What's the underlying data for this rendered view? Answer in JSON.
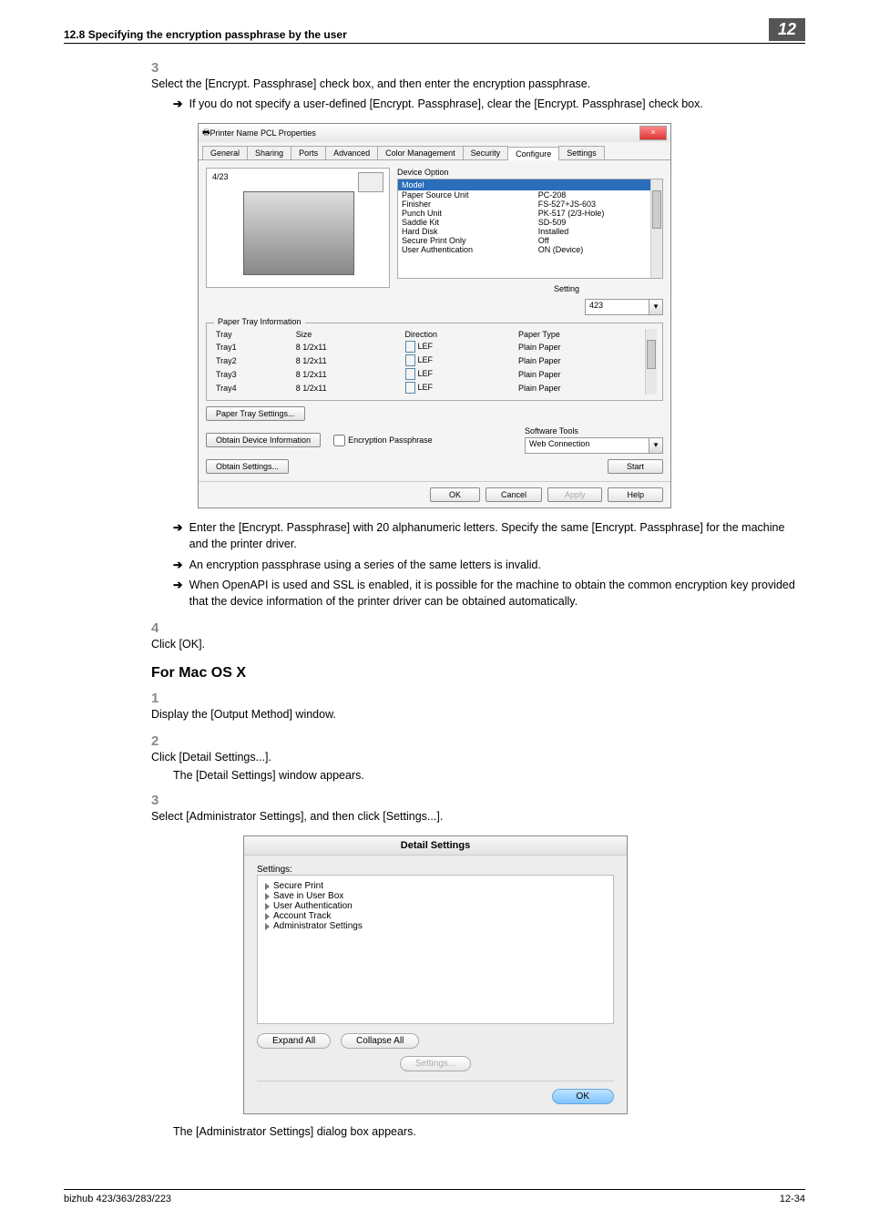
{
  "header": {
    "left": "12.8   Specifying the encryption passphrase by the user",
    "right": "12"
  },
  "step3": {
    "num": "3",
    "text": "Select the [Encrypt. Passphrase] check box, and then enter the encryption passphrase.",
    "sub1": "If you do not specify a user-defined [Encrypt. Passphrase], clear the [Encrypt. Passphrase] check box."
  },
  "dialog1": {
    "title": "Printer Name PCL Properties",
    "tabs": [
      "General",
      "Sharing",
      "Ports",
      "Advanced",
      "Color Management",
      "Security",
      "Configure",
      "Settings"
    ],
    "activeTab": "Configure",
    "previewNum": "4/23",
    "devopt_label": "Device Option",
    "model_label": "Model",
    "rows": [
      {
        "k": "Paper Source Unit",
        "v": "PC-208"
      },
      {
        "k": "Finisher",
        "v": "FS-527+JS-603"
      },
      {
        "k": "Punch Unit",
        "v": "PK-517 (2/3-Hole)"
      },
      {
        "k": "Saddle Kit",
        "v": "SD-509"
      },
      {
        "k": "Hard Disk",
        "v": "Installed"
      },
      {
        "k": "Secure Print Only",
        "v": "Off"
      },
      {
        "k": "User Authentication",
        "v": "ON (Device)"
      }
    ],
    "setting_label": "Setting",
    "setting_value": "423",
    "tray_section": "Paper Tray Information",
    "tray_headers": [
      "Tray",
      "Size",
      "Direction",
      "Paper Type"
    ],
    "trays": [
      {
        "t": "Tray1",
        "s": "8 1/2x11",
        "d": "LEF",
        "p": "Plain Paper"
      },
      {
        "t": "Tray2",
        "s": "8 1/2x11",
        "d": "LEF",
        "p": "Plain Paper"
      },
      {
        "t": "Tray3",
        "s": "8 1/2x11",
        "d": "LEF",
        "p": "Plain Paper"
      },
      {
        "t": "Tray4",
        "s": "8 1/2x11",
        "d": "LEF",
        "p": "Plain Paper"
      }
    ],
    "paper_tray_btn": "Paper Tray Settings...",
    "obtain_device_btn": "Obtain Device Information",
    "obtain_settings_btn": "Obtain Settings...",
    "enc_chk": "Encryption Passphrase",
    "soft_tools": "Software Tools",
    "web_conn": "Web Connection",
    "start_btn": "Start",
    "ok": "OK",
    "cancel": "Cancel",
    "apply": "Apply",
    "help": "Help"
  },
  "bullets_after": {
    "b1": "Enter the [Encrypt. Passphrase] with 20 alphanumeric letters. Specify the same [Encrypt. Passphrase] for the machine and the printer driver.",
    "b2": "An encryption passphrase using a series of the same letters is invalid.",
    "b3": "When OpenAPI is used and SSL is enabled, it is possible for the machine to obtain the common encryption key provided that the device information of the printer driver can be obtained automatically."
  },
  "step4": {
    "num": "4",
    "text": "Click [OK]."
  },
  "mac_heading": "For Mac OS X",
  "mac_steps": {
    "s1": {
      "num": "1",
      "text": "Display the [Output Method] window."
    },
    "s2": {
      "num": "2",
      "text": "Click [Detail Settings...].",
      "after": "The [Detail Settings] window appears."
    },
    "s3": {
      "num": "3",
      "text": "Select [Administrator Settings], and then click [Settings...]."
    }
  },
  "dialog2": {
    "title": "Detail Settings",
    "settings_label": "Settings:",
    "items": [
      "Secure Print",
      "Save in User Box",
      "User Authentication",
      "Account Track",
      "Administrator Settings"
    ],
    "expand": "Expand All",
    "collapse": "Collapse All",
    "settings_btn": "Settings...",
    "ok": "OK"
  },
  "after_dialog2": "The [Administrator Settings] dialog box appears.",
  "footer": {
    "left": "bizhub 423/363/283/223",
    "right": "12-34"
  }
}
